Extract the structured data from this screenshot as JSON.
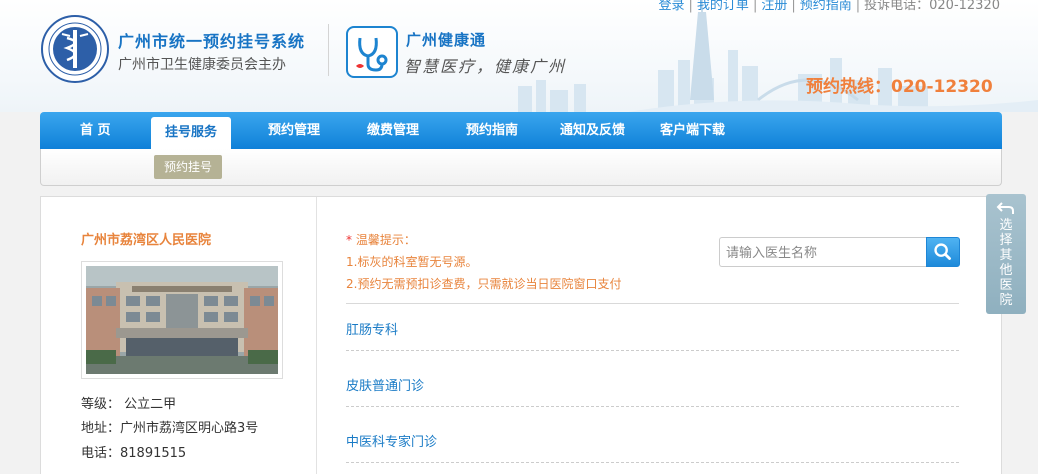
{
  "top_links": {
    "login": "登录",
    "my_orders": "我的订单",
    "register": "注册",
    "guide": "预约指南",
    "complaint": "投诉电话：020-12320"
  },
  "brand": {
    "org_title": "广州市统一预约挂号系统",
    "org_sub": "广州市卫生健康委员会主办",
    "app_title": "广州健康通",
    "app_slogan": "智慧医疗，健康广州",
    "hotline": "预约热线：020-12320"
  },
  "nav": {
    "items": [
      {
        "label": "首 页"
      },
      {
        "label": "挂号服务"
      },
      {
        "label": "预约管理"
      },
      {
        "label": "缴费管理"
      },
      {
        "label": "预约指南"
      },
      {
        "label": "通知及反馈"
      },
      {
        "label": "客户端下载"
      }
    ],
    "active_index": 1,
    "sub_item": "预约挂号"
  },
  "hospital": {
    "name": "广州市荔湾区人民医院",
    "level": "等级：  公立二甲",
    "address": "地址：广州市荔湾区明心路3号",
    "phone": "电话：81891515"
  },
  "notice": {
    "title": "温馨提示：",
    "line1": "1.标灰的科室暂无号源。",
    "line2": "2.预约无需预扣诊查费，只需就诊当日医院窗口支付"
  },
  "search": {
    "placeholder": "请输入医生名称"
  },
  "departments": [
    {
      "name": "肛肠专科"
    },
    {
      "name": "皮肤普通门诊"
    },
    {
      "name": "中医科专家门诊"
    }
  ],
  "side_tab": {
    "label": "选择其他医院"
  },
  "colors": {
    "nav_blue": "#0f80d8",
    "brand_blue": "#1874c4",
    "accent_orange": "#e8843c",
    "link_blue": "#1a7bc6"
  }
}
